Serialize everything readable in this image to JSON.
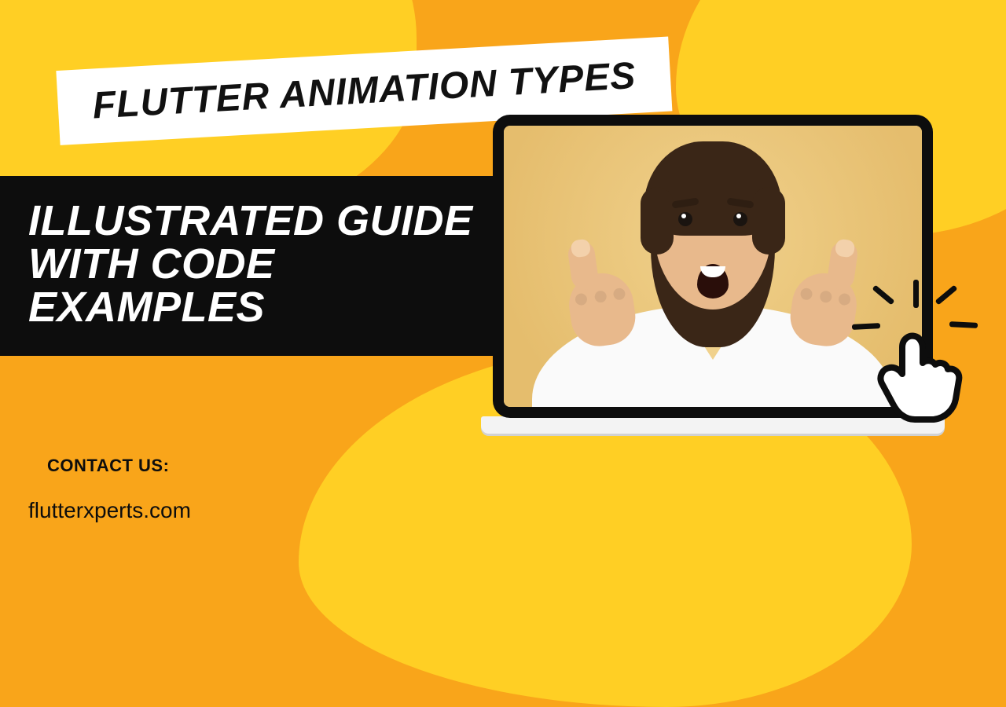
{
  "title": "FLUTTER ANIMATION TYPES",
  "subtitle_line1": "ILLUSTRATED GUIDE",
  "subtitle_line2": "WITH CODE EXAMPLES",
  "contact_label": "CONTACT US:",
  "contact_url": "flutterxperts.com",
  "colors": {
    "bg_primary": "#f9a51a",
    "bg_blob": "#ffcf24",
    "dark": "#0d0d0d",
    "white": "#ffffff"
  },
  "icons": {
    "click": "click-cursor-hand-icon",
    "image": "thumbs-up-person"
  }
}
